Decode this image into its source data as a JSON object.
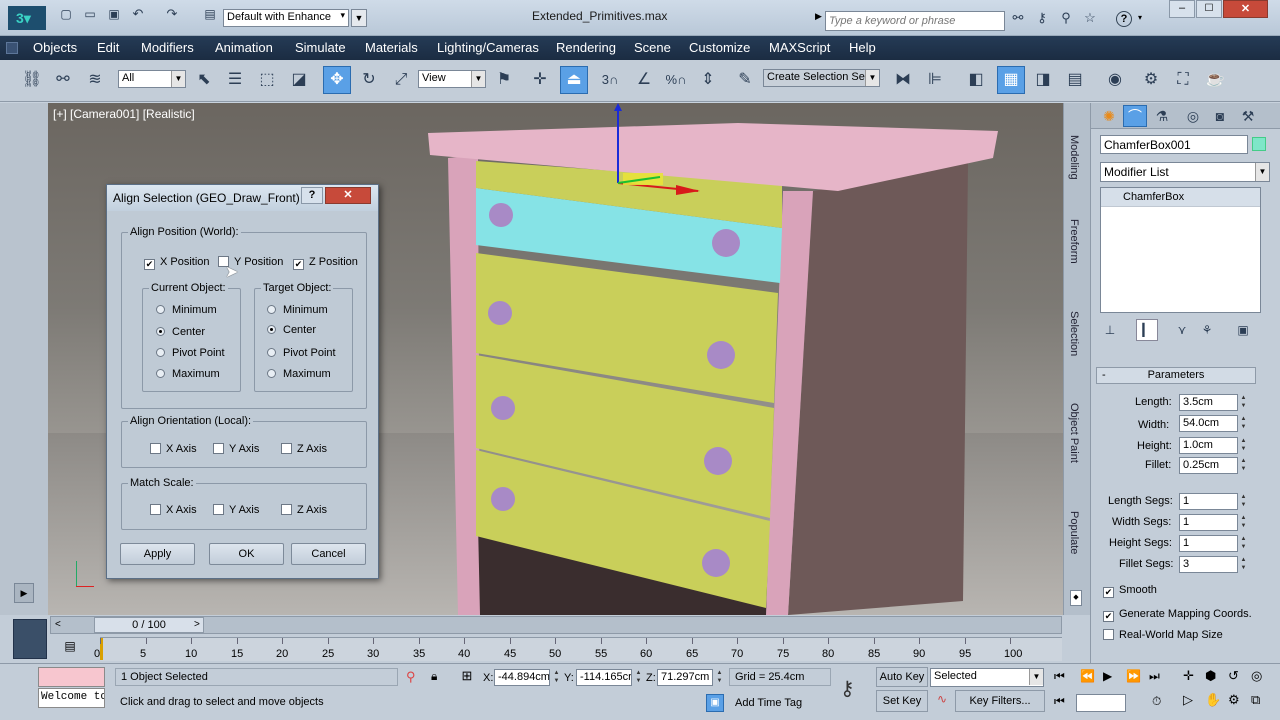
{
  "titlebar": {
    "workspace": "Default with Enhance",
    "filename": "Extended_Primitives.max",
    "search_placeholder": "Type a keyword or phrase",
    "help_label": "?"
  },
  "menu": [
    "Objects",
    "Edit",
    "Modifiers",
    "Animation",
    "Simulate",
    "Materials",
    "Lighting/Cameras",
    "Rendering",
    "Scene",
    "Customize",
    "MAXScript",
    "Help"
  ],
  "toolbar": {
    "filter_value": "All",
    "refcoord_value": "View",
    "selection_set_value": "Create Selection Se",
    "snap_3": "3",
    "angle_snap": "",
    "percent_snap": "%"
  },
  "viewport": {
    "label": "[+] [Camera001] [Realistic]"
  },
  "dialog": {
    "title": "Align Selection (GEO_Draw_Front)",
    "align_position_label": "Align Position (World):",
    "x_position": "X Position",
    "y_position": "Y Position",
    "z_position": "Z Position",
    "current_object_label": "Current Object:",
    "target_object_label": "Target Object:",
    "options": [
      "Minimum",
      "Center",
      "Pivot Point",
      "Maximum"
    ],
    "align_orientation_label": "Align Orientation (Local):",
    "match_scale_label": "Match Scale:",
    "x_axis": "X Axis",
    "y_axis": "Y Axis",
    "z_axis": "Z Axis",
    "apply": "Apply",
    "ok": "OK",
    "cancel": "Cancel"
  },
  "side_tabs": [
    "Modeling",
    "Freeform",
    "Selection",
    "Object Paint",
    "Populate"
  ],
  "command_panel": {
    "object_name": "ChamferBox001",
    "modifier_list": "Modifier List",
    "stack_item": "ChamferBox",
    "rollout_title": "Parameters",
    "params": [
      {
        "label": "Length:",
        "value": "3.5cm"
      },
      {
        "label": "Width:",
        "value": "54.0cm"
      },
      {
        "label": "Height:",
        "value": "1.0cm"
      },
      {
        "label": "Fillet:",
        "value": "0.25cm"
      }
    ],
    "segs": [
      {
        "label": "Length Segs:",
        "value": "1"
      },
      {
        "label": "Width Segs:",
        "value": "1"
      },
      {
        "label": "Height Segs:",
        "value": "1"
      },
      {
        "label": "Fillet Segs:",
        "value": "3"
      }
    ],
    "smooth": "Smooth",
    "gen_mapping": "Generate Mapping Coords.",
    "real_world": "Real-World Map Size"
  },
  "timeline": {
    "frame_display": "0 / 100",
    "ticks": [
      "0",
      "5",
      "10",
      "15",
      "20",
      "25",
      "30",
      "35",
      "40",
      "45",
      "50",
      "55",
      "60",
      "65",
      "70",
      "75",
      "80",
      "85",
      "90",
      "95",
      "100"
    ]
  },
  "status": {
    "listener_text": "Welcome to M",
    "selected_text": "1 Object Selected",
    "prompt_text": "Click and drag to select and move objects",
    "x_label": "X:",
    "x_value": "-44.894cm",
    "y_label": "Y:",
    "y_value": "-114.165cr",
    "z_label": "Z:",
    "z_value": "71.297cm",
    "grid": "Grid = 25.4cm",
    "add_time_tag": "Add Time Tag",
    "auto_key": "Auto Key",
    "set_key": "Set Key",
    "key_mode": "Selected",
    "key_filters": "Key Filters..."
  },
  "colors": {
    "menubar": "#1f3350",
    "active_button": "#5aa0e6",
    "object_color_swatch": "#7fe6c8",
    "chest_body": "#d9a3ba",
    "drawer_front": "#c9cf5a",
    "selected_drawer": "#86e3e6",
    "knob": "#a88ac6"
  }
}
